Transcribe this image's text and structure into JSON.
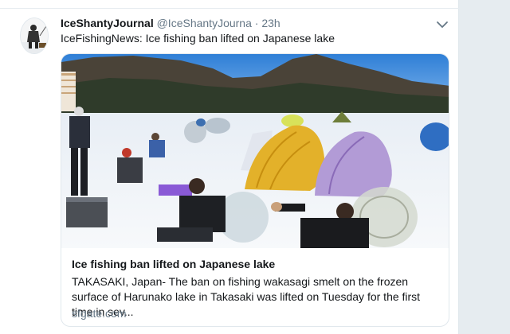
{
  "tweet": {
    "display_name": "IceShantyJournal",
    "handle": "@IceShantyJourna",
    "separator": "·",
    "time": "23h",
    "text": "IceFishingNews: Ice fishing ban lifted on Japanese lake",
    "menu_icon": "chevron-down-icon",
    "avatar_icon": "ice-fisherman-avatar"
  },
  "card": {
    "title": "Ice fishing ban lifted on Japanese lake",
    "description": "TAKASAKI, Japan- The ban on fishing wakasagi smelt on the frozen surface of Harunako lake in Takasaki was lifted on Tuesday for the first time in sev...",
    "domain": "sfgate.com",
    "image": "photo of ice fishermen and colorful tent shelters on a frozen lake with mountains"
  },
  "colors": {
    "background": "#e6ecf0",
    "text_primary": "#14171a",
    "text_secondary": "#657786",
    "border": "#e1e8ed"
  }
}
